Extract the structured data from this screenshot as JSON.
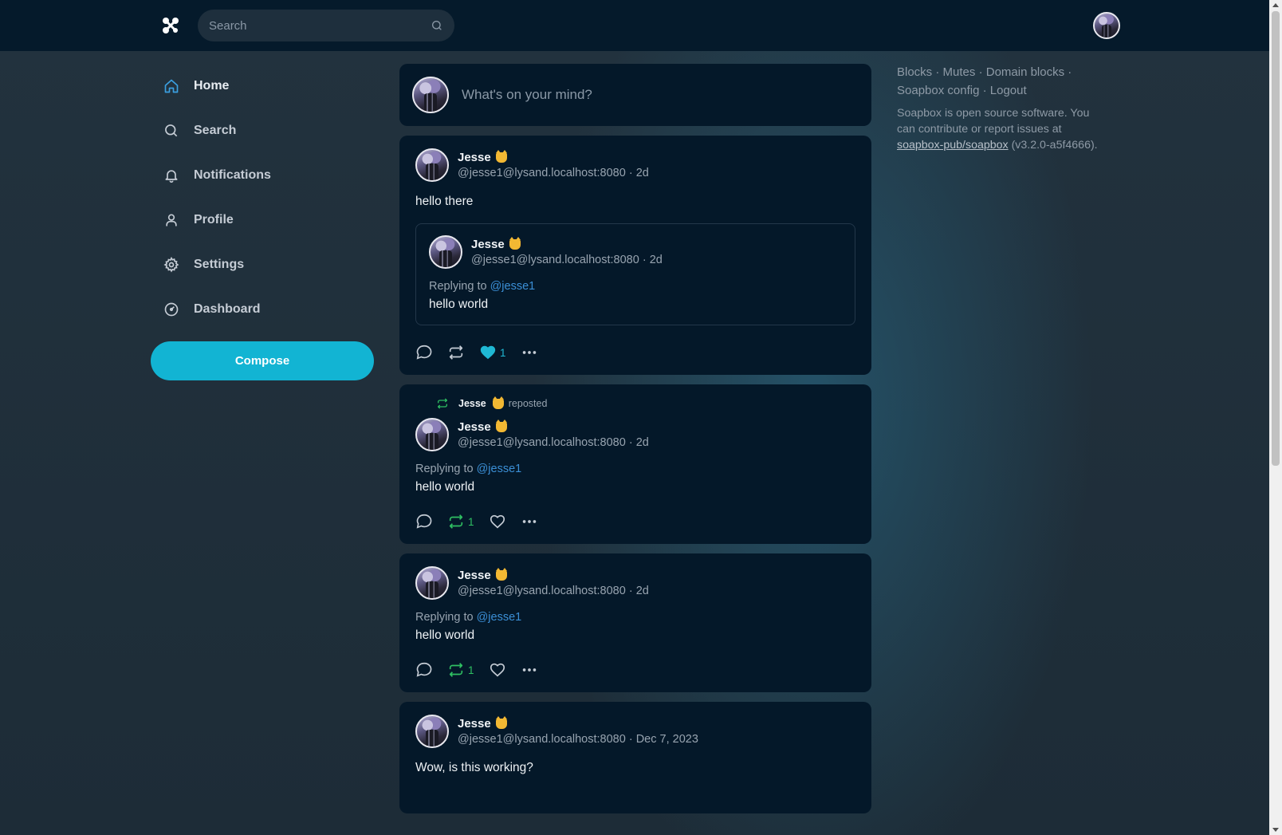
{
  "search": {
    "placeholder": "Search"
  },
  "nav": [
    {
      "label": "Home",
      "icon": "home-icon"
    },
    {
      "label": "Search",
      "icon": "search-icon"
    },
    {
      "label": "Notifications",
      "icon": "bell-icon"
    },
    {
      "label": "Profile",
      "icon": "user-icon"
    },
    {
      "label": "Settings",
      "icon": "gear-icon"
    },
    {
      "label": "Dashboard",
      "icon": "dashboard-icon"
    }
  ],
  "compose_label": "Compose",
  "composer": {
    "placeholder": "What's on your mind?"
  },
  "posts": [
    {
      "display_name": "Jesse",
      "acct": "@jesse1@lysand.localhost:8080 · 2d",
      "content": "hello there",
      "quote": {
        "display_name": "Jesse",
        "acct": "@jesse1@lysand.localhost:8080 · 2d",
        "replying_prefix": "Replying to",
        "replying_to": "@jesse1",
        "content": "hello world"
      },
      "favourites": "1"
    },
    {
      "reposter": "Jesse",
      "reposted_label": "reposted",
      "display_name": "Jesse",
      "acct": "@jesse1@lysand.localhost:8080 · 2d",
      "replying_prefix": "Replying to",
      "replying_to": "@jesse1",
      "content": "hello world",
      "reblogs": "1"
    },
    {
      "display_name": "Jesse",
      "acct": "@jesse1@lysand.localhost:8080 · 2d",
      "replying_prefix": "Replying to",
      "replying_to": "@jesse1",
      "content": "hello world",
      "reblogs": "1"
    },
    {
      "display_name": "Jesse",
      "acct": "@jesse1@lysand.localhost:8080 · Dec 7, 2023",
      "content": "Wow, is this working?"
    }
  ],
  "aside": {
    "links": [
      "Blocks",
      "Mutes",
      "Domain blocks",
      "Soapbox config",
      "Logout"
    ],
    "separator": "·",
    "info_prefix": "Soapbox is open source software. You can contribute or report issues at",
    "repo_link": "soapbox-pub/soapbox",
    "version": "(v3.2.0-a5f4666)."
  },
  "colors": {
    "accent": "#12b4d3",
    "topbar": "#051a2b",
    "card": "#041829",
    "repost_green": "#2fbf62",
    "link": "#3b8fd6"
  }
}
